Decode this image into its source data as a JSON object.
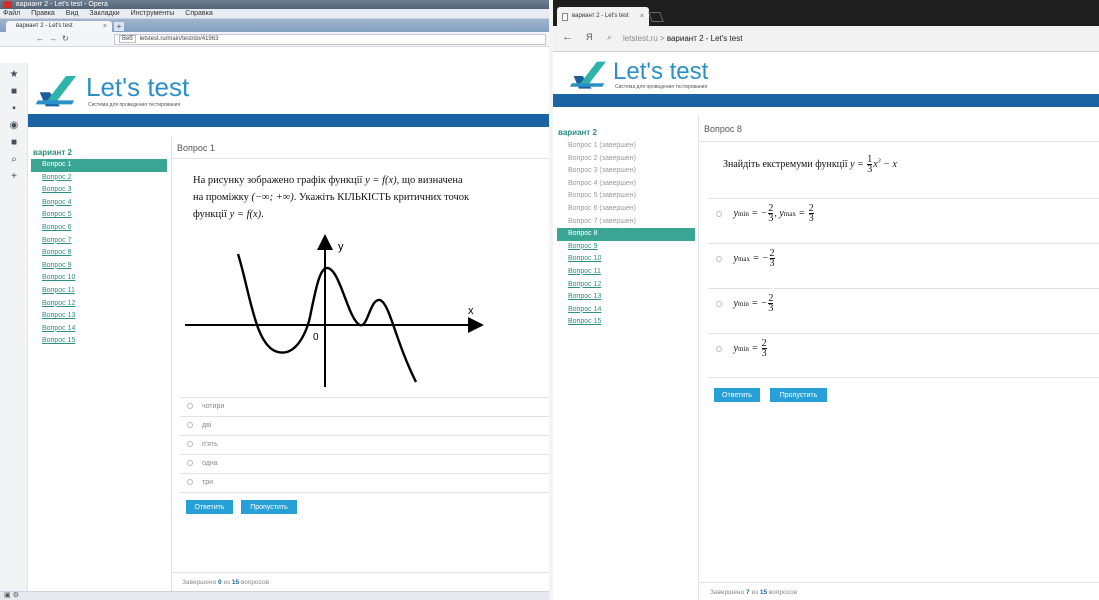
{
  "left": {
    "window_title": "вариант 2 - Let's test - Opera",
    "menu": [
      "Файл",
      "Правка",
      "Вид",
      "Закладки",
      "Инструменты",
      "Справка"
    ],
    "tab_title": "вариант 2 - Let's test",
    "url_badge": "Веб",
    "url": "letstest.ru/main/test/do/41963",
    "logo": "Let's test",
    "logo_sub": "Система для проведения тестирования",
    "variant": "вариант 2",
    "questions": [
      "Вопрос 1",
      "Вопрос 2",
      "Вопрос 3",
      "Вопрос 4",
      "Вопрос 5",
      "Вопрос 6",
      "Вопрос 7",
      "Вопрос 8",
      "Вопрос 9",
      "Вопрос 10",
      "Вопрос 11",
      "Вопрос 12",
      "Вопрос 13",
      "Вопрос 14",
      "Вопрос 15"
    ],
    "question_header": "Вопрос 1",
    "question_line1a": "На рисунку зображено графік функції",
    "question_line1b": ", що визначена",
    "question_line2a": "на проміжку",
    "question_line2b": ". Укажіть КІЛЬКІСТЬ критичних точок",
    "question_line3": "функції",
    "fx1": "y = f(x)",
    "interval": "(−∞; +∞)",
    "axis_y": "y",
    "axis_x": "x",
    "origin": "0",
    "options": [
      "чотири",
      "дві",
      "п'ять",
      "одна",
      "три"
    ],
    "answer_button": "Ответить",
    "skip_button": "Пропустить",
    "footer_prefix": "Завершено",
    "footer_done": "0",
    "footer_mid": "из",
    "footer_total": "15",
    "footer_suffix": "вопросов"
  },
  "right": {
    "tab_title": "вариант 2 - Let's test",
    "search_letter": "Я",
    "domain": "letstest.ru",
    "page_title": "вариант 2 - Let's test",
    "logo": "Let's test",
    "logo_sub": "Система для проведения тестирования",
    "variant": "вариант 2",
    "questions": [
      "Вопрос 1 (завершен)",
      "Вопрос 2 (завершен)",
      "Вопрос 3 (завершен)",
      "Вопрос 4 (завершен)",
      "Вопрос 5 (завершен)",
      "Вопрос 6 (завершен)",
      "Вопрос 7 (завершен)",
      "Вопрос 8",
      "Вопрос 9",
      "Вопрос 10",
      "Вопрос 11",
      "Вопрос 12",
      "Вопрос 13",
      "Вопрос 14",
      "Вопрос 15"
    ],
    "question_header": "Вопрос 8",
    "question_text": "Знайдіть екстремуми функції",
    "answer_button": "Ответить",
    "skip_button": "Пропустить",
    "footer_prefix": "Завершено",
    "footer_done": "7",
    "footer_mid": "из",
    "footer_total": "15",
    "footer_suffix": "вопросов"
  },
  "colors": {
    "accent": "#2a90c8",
    "bar": "#1a64a3",
    "active": "#3aa595",
    "link": "#2b8f84",
    "button": "#27a0d8"
  }
}
